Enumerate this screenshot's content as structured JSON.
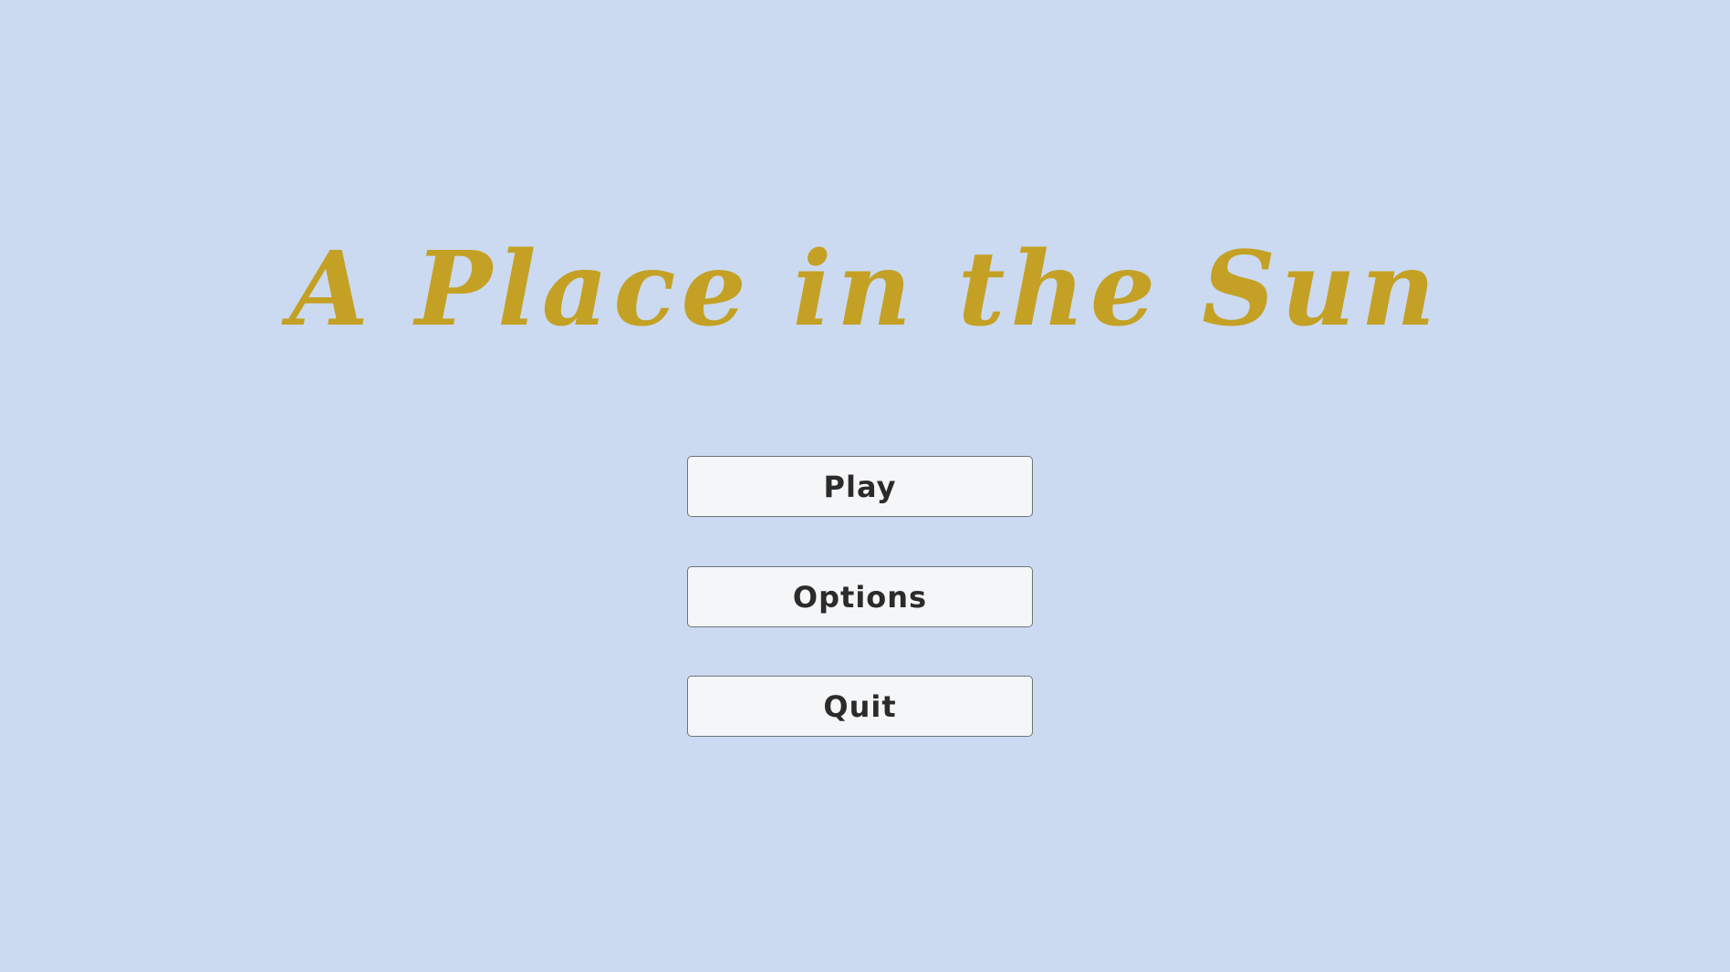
{
  "game": {
    "title": "A Place in the Sun",
    "title_color": "#c4a124",
    "background_color": "#cbdaf0"
  },
  "menu": {
    "play_label": "Play",
    "options_label": "Options",
    "quit_label": "Quit"
  }
}
